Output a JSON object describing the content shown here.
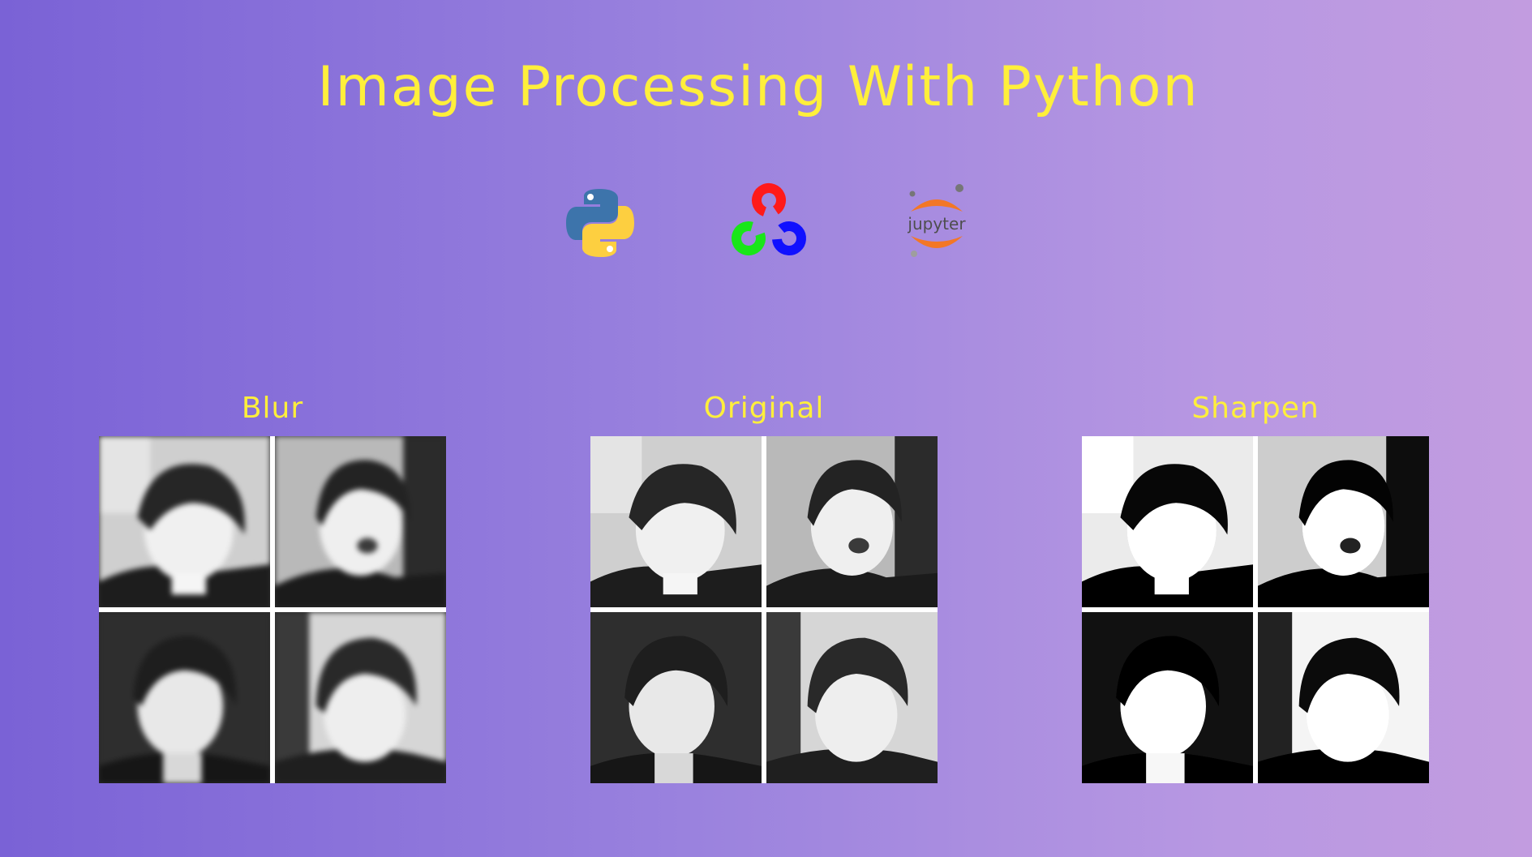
{
  "title": "Image Processing With Python",
  "logos": [
    {
      "icon": "python-logo-icon"
    },
    {
      "icon": "opencv-logo-icon"
    },
    {
      "icon": "jupyter-logo-icon",
      "text": "jupyter"
    }
  ],
  "panels": [
    {
      "label": "Blur",
      "image": "blurred-photo"
    },
    {
      "label": "Original",
      "image": "original-photo"
    },
    {
      "label": "Sharpen",
      "image": "sharpened-photo"
    }
  ],
  "colors": {
    "title": "#ffef3b",
    "gradient_start": "#7a62d6",
    "gradient_end": "#c29ce0"
  }
}
